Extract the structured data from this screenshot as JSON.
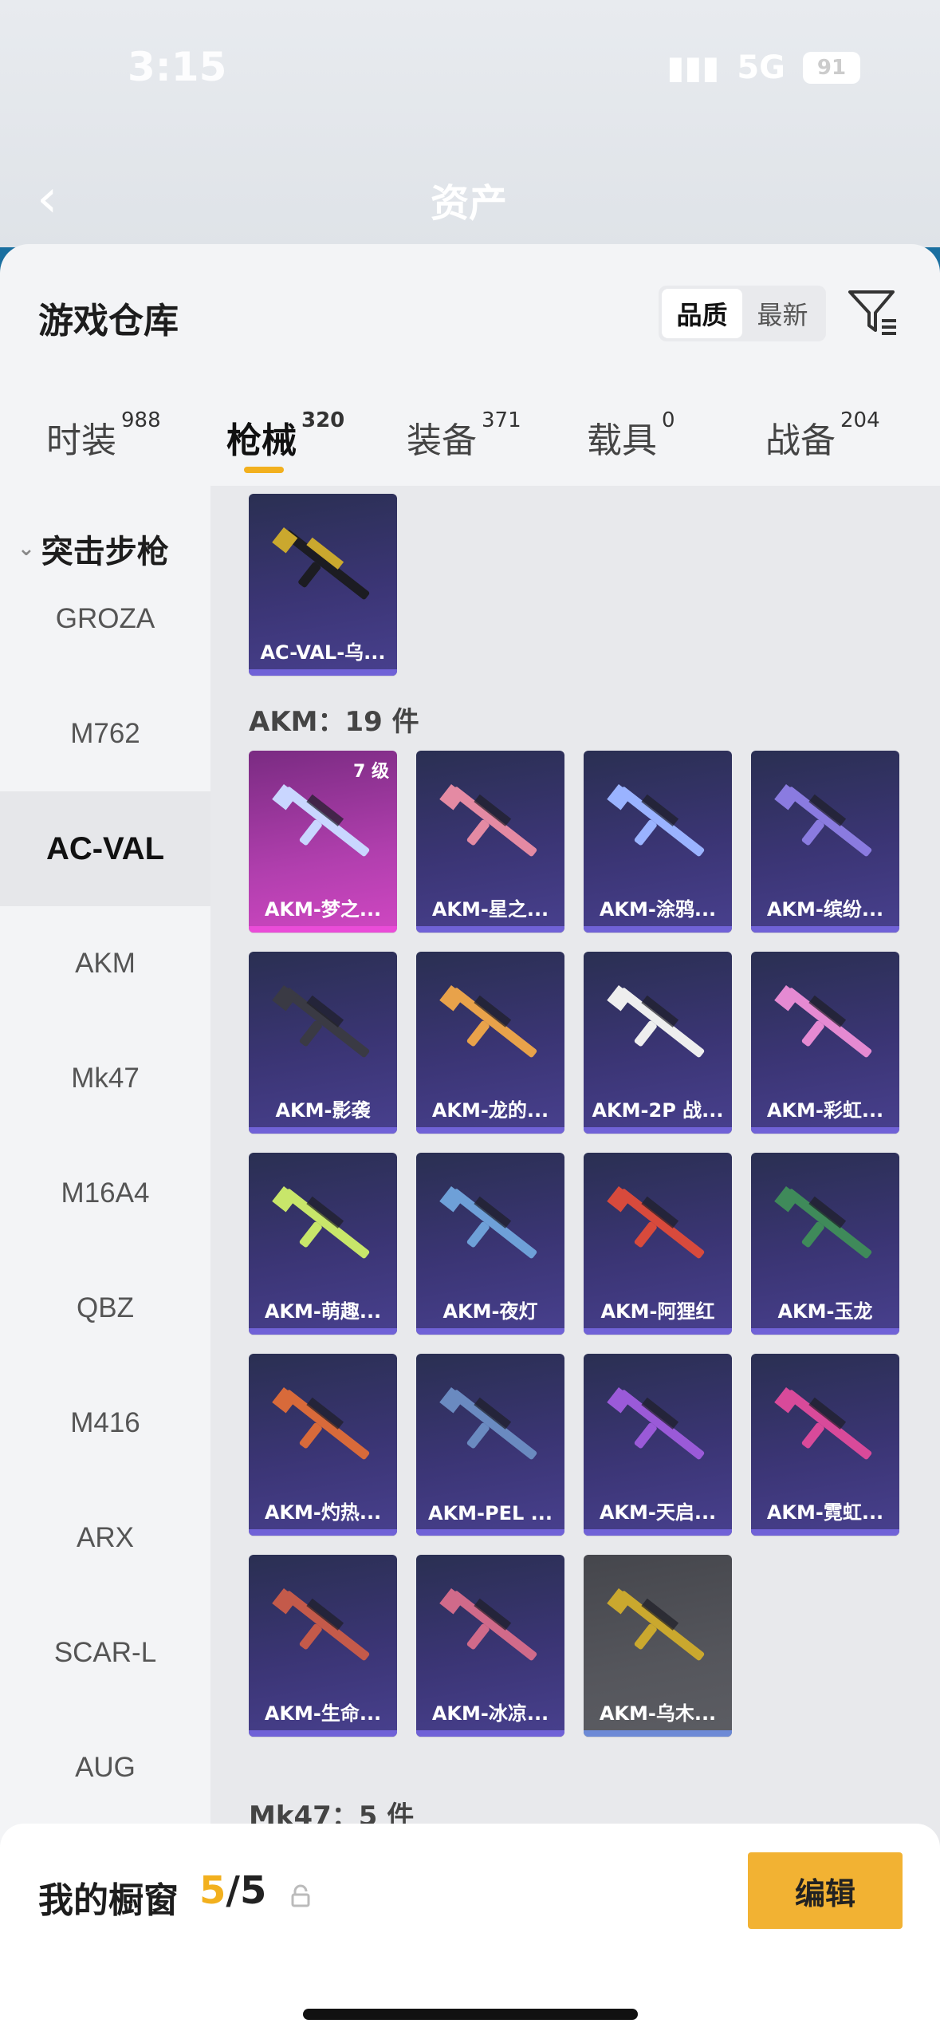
{
  "status_bar": {
    "time": "3:15",
    "network": "5G",
    "battery": "91"
  },
  "nav": {
    "back_icon": "chevron-left-icon",
    "title": "资产"
  },
  "sheet": {
    "title": "游戏仓库",
    "sort": {
      "options": [
        "品质",
        "最新"
      ],
      "selected": "品质"
    },
    "filter_icon": "filter-icon"
  },
  "tabs": [
    {
      "label": "时装",
      "count": "988"
    },
    {
      "label": "枪械",
      "count": "320",
      "active": true
    },
    {
      "label": "装备",
      "count": "371"
    },
    {
      "label": "载具",
      "count": "0"
    },
    {
      "label": "战备",
      "count": "204"
    }
  ],
  "sidebar": {
    "category": "突击步枪",
    "items": [
      "GROZA",
      "M762",
      "AC-VAL",
      "AKM",
      "Mk47",
      "M16A4",
      "QBZ",
      "M416",
      "ARX",
      "SCAR-L",
      "AUG"
    ],
    "selected": "AC-VAL"
  },
  "sections": {
    "acval_card": "AC-VAL-乌...",
    "akm_label": "AKM：19 件",
    "akm_cards": [
      {
        "label": "AKM-梦之...",
        "level": "7 级"
      },
      {
        "label": "AKM-星之..."
      },
      {
        "label": "AKM-涂鸦..."
      },
      {
        "label": "AKM-缤纷..."
      },
      {
        "label": "AKM-影袭"
      },
      {
        "label": "AKM-龙的..."
      },
      {
        "label": "AKM-2P 战..."
      },
      {
        "label": "AKM-彩虹..."
      },
      {
        "label": "AKM-萌趣..."
      },
      {
        "label": "AKM-夜灯"
      },
      {
        "label": "AKM-阿狸红"
      },
      {
        "label": "AKM-玉龙"
      },
      {
        "label": "AKM-灼热..."
      },
      {
        "label": "AKM-PEL ..."
      },
      {
        "label": "AKM-天启..."
      },
      {
        "label": "AKM-霓虹..."
      },
      {
        "label": "AKM-生命..."
      },
      {
        "label": "AKM-冰凉..."
      },
      {
        "label": "AKM-乌木..."
      }
    ],
    "mk47_label": "Mk47：5 件"
  },
  "share_icon": "share-external-icon",
  "bottom": {
    "title": "我的橱窗",
    "current": "5",
    "total": "/5",
    "lock_icon": "lock-icon",
    "edit_label": "编辑"
  },
  "colors": {
    "accent": "#f2b01e",
    "card_purple": "#3b3575",
    "card_pink": "#b13fae"
  }
}
